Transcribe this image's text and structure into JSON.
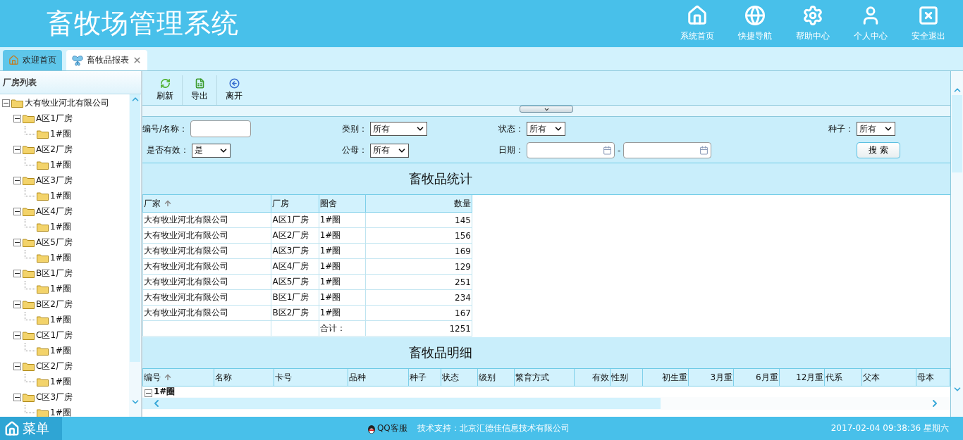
{
  "header": {
    "title": "畜牧场管理系统",
    "nav": [
      {
        "kind": "home",
        "label": "系统首页"
      },
      {
        "kind": "globe",
        "label": "快捷导航"
      },
      {
        "kind": "gear",
        "label": "帮助中心"
      },
      {
        "kind": "user",
        "label": "个人中心"
      },
      {
        "kind": "exit",
        "label": "安全退出"
      }
    ]
  },
  "tabs": [
    {
      "kind": "home",
      "label": "欢迎首页",
      "selected": false,
      "closable": false
    },
    {
      "kind": "butterfly",
      "label": "畜牧品报表",
      "selected": true,
      "closable": true
    }
  ],
  "sidebar": {
    "title": "厂房列表",
    "tree": [
      {
        "label": "大有牧业河北有限公司",
        "expanded": true,
        "children": [
          {
            "label": "A区1厂房",
            "expanded": true,
            "children": [
              {
                "label": "1#圈"
              }
            ]
          },
          {
            "label": "A区2厂房",
            "expanded": true,
            "children": [
              {
                "label": "1#圈"
              }
            ]
          },
          {
            "label": "A区3厂房",
            "expanded": true,
            "children": [
              {
                "label": "1#圈"
              }
            ]
          },
          {
            "label": "A区4厂房",
            "expanded": true,
            "children": [
              {
                "label": "1#圈"
              }
            ]
          },
          {
            "label": "A区5厂房",
            "expanded": true,
            "children": [
              {
                "label": "1#圈"
              }
            ]
          },
          {
            "label": "B区1厂房",
            "expanded": true,
            "children": [
              {
                "label": "1#圈"
              }
            ]
          },
          {
            "label": "B区2厂房",
            "expanded": true,
            "children": [
              {
                "label": "1#圈"
              }
            ]
          },
          {
            "label": "C区1厂房",
            "expanded": true,
            "children": [
              {
                "label": "1#圈"
              }
            ]
          },
          {
            "label": "C区2厂房",
            "expanded": true,
            "children": [
              {
                "label": "1#圈"
              }
            ]
          },
          {
            "label": "C区3厂房",
            "expanded": true,
            "children": [
              {
                "label": "1#圈"
              }
            ]
          }
        ]
      }
    ]
  },
  "toolbar": [
    {
      "kind": "refresh",
      "label": "刷新"
    },
    {
      "kind": "export",
      "label": "导出"
    },
    {
      "kind": "leave",
      "label": "离开"
    }
  ],
  "filters": [
    {
      "kind": "text",
      "label": "编号/名称："
    },
    {
      "kind": "wideselect",
      "label": "类别：",
      "value": "所有"
    },
    {
      "kind": "select",
      "label": "状态：",
      "value": "所有"
    },
    {
      "kind": "select",
      "label": "种子：",
      "value": "所有"
    },
    {
      "kind": "select",
      "label": "是否有效：",
      "value": "是"
    },
    {
      "kind": "select",
      "label": "公母：",
      "value": "所有"
    },
    {
      "kind": "daterange",
      "label": "日期：",
      "separator": "-"
    },
    {
      "kind": "button",
      "label": "搜 索"
    }
  ],
  "stats": {
    "title": "畜牧品统计",
    "columns": [
      {
        "label": "厂家",
        "sorted": true,
        "kind": "text"
      },
      {
        "label": "厂房",
        "sorted": false,
        "kind": "text"
      },
      {
        "label": "圈舍",
        "sorted": false,
        "kind": "text"
      },
      {
        "label": "数量",
        "sorted": false,
        "kind": "number"
      }
    ],
    "rows": [
      [
        "大有牧业河北有限公司",
        "A区1厂房",
        "1#圈",
        "145"
      ],
      [
        "大有牧业河北有限公司",
        "A区2厂房",
        "1#圈",
        "156"
      ],
      [
        "大有牧业河北有限公司",
        "A区3厂房",
        "1#圈",
        "169"
      ],
      [
        "大有牧业河北有限公司",
        "A区4厂房",
        "1#圈",
        "129"
      ],
      [
        "大有牧业河北有限公司",
        "A区5厂房",
        "1#圈",
        "251"
      ],
      [
        "大有牧业河北有限公司",
        "B区1厂房",
        "1#圈",
        "234"
      ],
      [
        "大有牧业河北有限公司",
        "B区2厂房",
        "1#圈",
        "167"
      ]
    ],
    "total_label": "合计：",
    "total": "1251"
  },
  "detail": {
    "title": "畜牧品明细",
    "columns": [
      {
        "label": "编号",
        "sorted": true,
        "kind": "text"
      },
      {
        "label": "名称",
        "sorted": false,
        "kind": "text"
      },
      {
        "label": "卡号",
        "sorted": false,
        "kind": "text"
      },
      {
        "label": "品种",
        "sorted": false,
        "kind": "text"
      },
      {
        "label": "种子",
        "sorted": false,
        "kind": "text"
      },
      {
        "label": "状态",
        "sorted": false,
        "kind": "text"
      },
      {
        "label": "级别",
        "sorted": false,
        "kind": "text"
      },
      {
        "label": "繁育方式",
        "sorted": false,
        "kind": "text"
      },
      {
        "label": "有效",
        "sorted": false,
        "kind": "number"
      },
      {
        "label": "性别",
        "sorted": false,
        "kind": "text"
      },
      {
        "label": "初生重",
        "sorted": false,
        "kind": "number"
      },
      {
        "label": "3月重",
        "sorted": false,
        "kind": "number"
      },
      {
        "label": "6月重",
        "sorted": false,
        "kind": "number"
      },
      {
        "label": "12月重",
        "sorted": false,
        "kind": "number"
      },
      {
        "label": "代系",
        "sorted": false,
        "kind": "text"
      },
      {
        "label": "父本",
        "sorted": false,
        "kind": "text"
      },
      {
        "label": "母本",
        "sorted": false,
        "kind": "text"
      }
    ],
    "group": {
      "label": "1#圈",
      "expanded": true
    }
  },
  "footer": {
    "menu": "菜单",
    "support_link": "QQ客服",
    "support": "技术支持：北京汇德佳信息技术有限公司",
    "datetime": "2017-02-04 09:38:36 星期六"
  }
}
